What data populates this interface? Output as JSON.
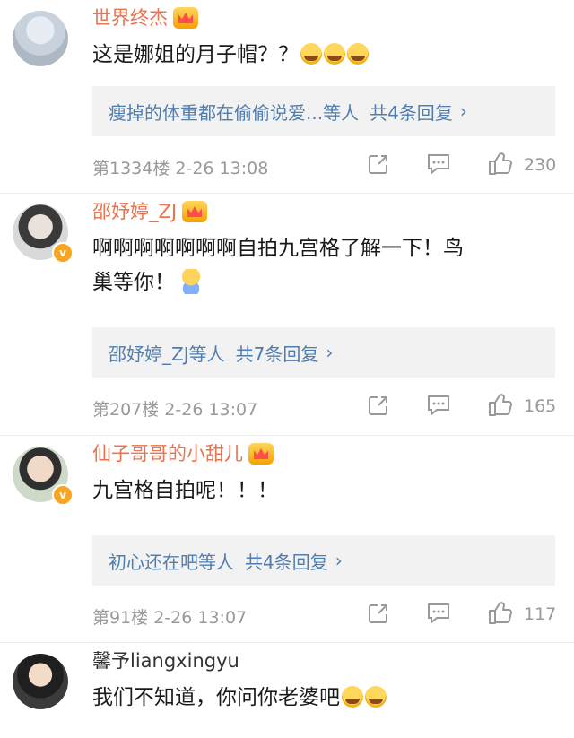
{
  "comments": [
    {
      "username": "世界终杰",
      "text": "这是娜姐的月子帽？？",
      "reply_summary": "瘦掉的体重都在偷偷说爱...等人",
      "reply_count": "共4条回复",
      "floor_time": "第1334楼  2-26 13:08",
      "likes": "230"
    },
    {
      "username": "邵妤婷_ZJ",
      "text_line1": "啊啊啊啊啊啊啊自拍九宫格了解一下！鸟",
      "text_line2": "巢等你！",
      "reply_summary": "邵妤婷_ZJ等人",
      "reply_count": "共7条回复",
      "floor_time": "第207楼  2-26 13:07",
      "likes": "165"
    },
    {
      "username": "仙子哥哥的小甜儿",
      "text": "九宫格自拍呢！！！",
      "reply_summary": "初心还在吧等人",
      "reply_count": "共4条回复",
      "floor_time": "第91楼  2-26 13:07",
      "likes": "117"
    },
    {
      "username": "馨予liangxingyu",
      "text": "我们不知道，你问你老婆吧"
    }
  ],
  "colors": {
    "username": "#eb7350",
    "link": "#507daf",
    "meta": "#999999",
    "text": "#1a1a1a"
  },
  "icons": {
    "vip": "crown-icon",
    "verified": "verified-badge-icon",
    "repost": "repost-icon",
    "comment": "comment-icon",
    "like": "like-icon",
    "chevron": "chevron-right-icon"
  }
}
